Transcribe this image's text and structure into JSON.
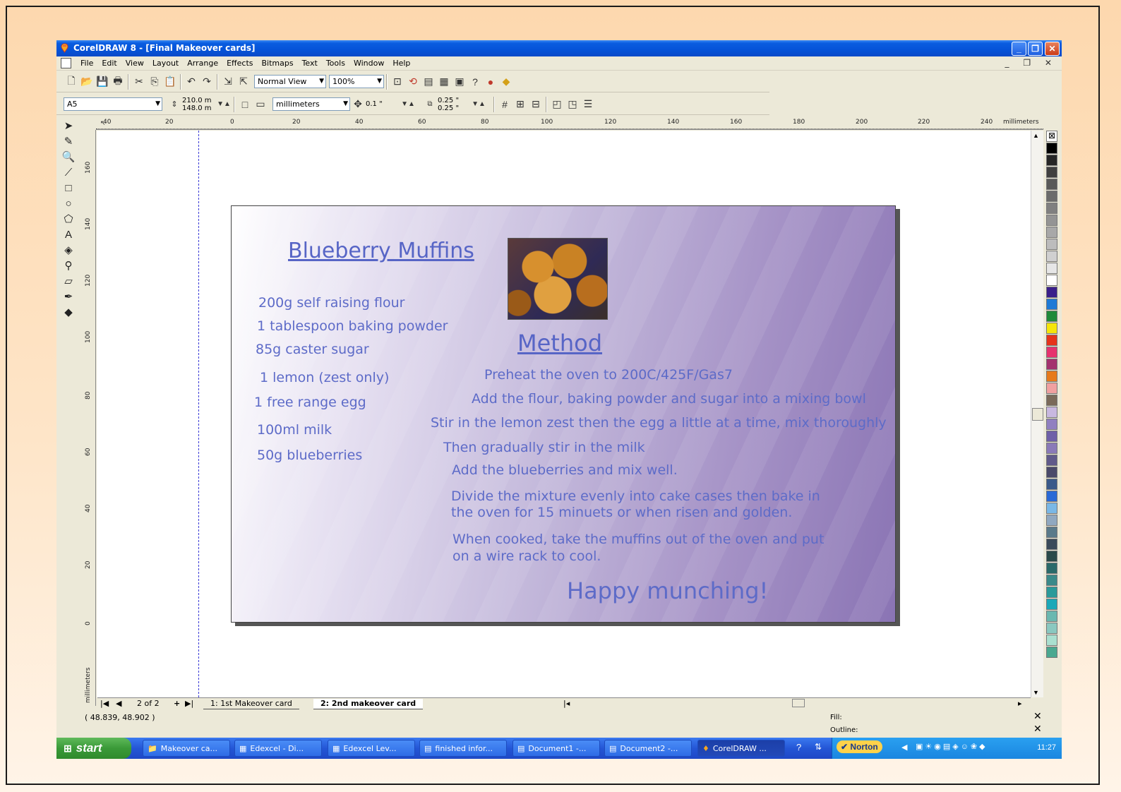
{
  "window": {
    "title": "CorelDRAW 8 - [Final Makeover cards]"
  },
  "menu": [
    "File",
    "Edit",
    "View",
    "Layout",
    "Arrange",
    "Effects",
    "Bitmaps",
    "Text",
    "Tools",
    "Window",
    "Help"
  ],
  "toolbar": {
    "view_mode": "Normal View",
    "zoom": "100%"
  },
  "property_bar": {
    "paper_size": "A5",
    "width": "210.0 m",
    "height": "148.0 m",
    "units": "millimeters",
    "nudge": "0.1 \"",
    "dup_x": "0.25 \"",
    "dup_y": "0.25 \""
  },
  "ruler": {
    "h_labels": [
      "40",
      "20",
      "0",
      "20",
      "40",
      "60",
      "80",
      "100",
      "120",
      "140",
      "160",
      "180",
      "200",
      "220",
      "240"
    ],
    "h_units": "millimeters",
    "v_labels": [
      "160",
      "140",
      "120",
      "100",
      "80",
      "60",
      "40",
      "20",
      "0"
    ],
    "v_units": "millimeters"
  },
  "card": {
    "title": "Blueberry Muffins",
    "ingredients": [
      "200g self raising flour",
      "1 tablespoon baking powder",
      "85g caster sugar",
      "1 lemon (zest only)",
      "1 free range egg",
      "100ml milk",
      "50g blueberries"
    ],
    "method_heading": "Method",
    "method": [
      "Preheat the oven to 200C/425F/Gas7",
      "Add the flour, baking powder and sugar into a mixing bowl",
      "Stir in the lemon zest then the egg a little at a time, mix thoroughly",
      "Then gradually stir in the milk",
      "Add the blueberries and mix well.",
      "Divide the mixture evenly into cake cases then bake in",
      "the oven for 15 minuets or when risen and golden.",
      "When cooked, take the muffins out of the oven and put",
      "on a wire rack to cool."
    ],
    "closing": "Happy munching!",
    "colors": {
      "text": "#5d6bc8",
      "gradient_start": "#ffffff",
      "gradient_end": "#8a74b4"
    }
  },
  "page_nav": {
    "counter": "2 of 2",
    "tabs": [
      "1: 1st Makeover card",
      "2: 2nd makeover card"
    ]
  },
  "status": {
    "coords": "( 48.839, 48.902 )",
    "fill_label": "Fill:",
    "outline_label": "Outline:"
  },
  "taskbar": {
    "start": "start",
    "items": [
      "Makeover ca...",
      "Edexcel - Di...",
      "Edexcel Lev...",
      "finished infor...",
      "Document1 -...",
      "Document2 -...",
      "CorelDRAW ..."
    ],
    "norton": "Norton",
    "clock": "11:27"
  },
  "palette_colors": [
    "#000000",
    "#262626",
    "#404040",
    "#595959",
    "#6b6b6b",
    "#808080",
    "#949494",
    "#a8a8a8",
    "#bcbcbc",
    "#d0d0d0",
    "#e6e6e6",
    "#ffffff",
    "#3a1f8a",
    "#1e7ad6",
    "#1f8a3a",
    "#f5e50a",
    "#e6331a",
    "#e6336e",
    "#a3336e",
    "#e67a1a",
    "#f0a0a0",
    "#7a6a5a",
    "#c8b8e0",
    "#9080c0",
    "#6e60a8",
    "#8a7ab8",
    "#605a8a",
    "#4a4a6a",
    "#3a5a8a",
    "#2a6ad6",
    "#7ab8e6",
    "#90a8c0",
    "#5a7a8a",
    "#3a4a5a",
    "#2a4a4a",
    "#2a6a6a",
    "#3a8a8a",
    "#2a9a9a",
    "#1aa8b8",
    "#6ab8b0",
    "#8ac8c0",
    "#aae0d0",
    "#4aa890"
  ]
}
